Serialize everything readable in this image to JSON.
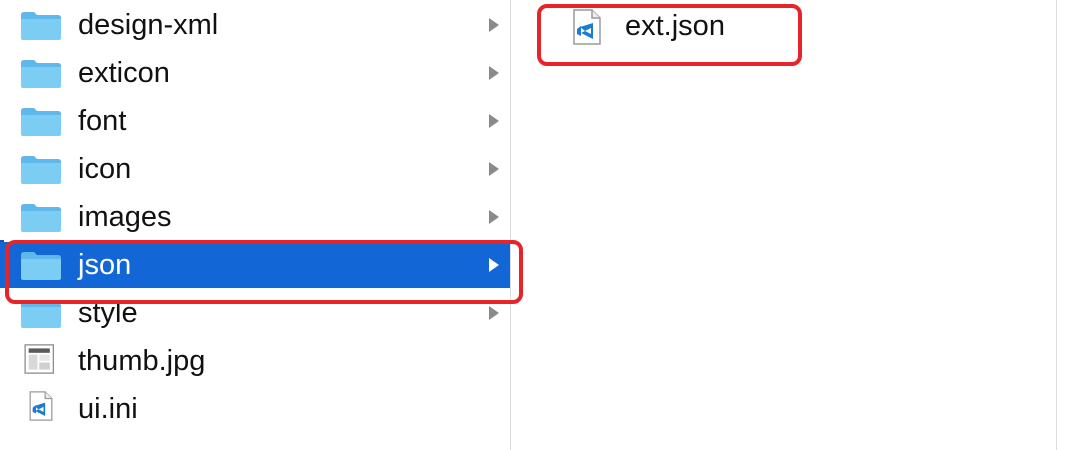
{
  "colors": {
    "selection": "#1266d6",
    "annotation": "#e8242b",
    "folder": "#6cc3ee",
    "vscode_blue": "#1c7bd4"
  },
  "left_column": {
    "items": [
      {
        "label": "design-xml",
        "kind": "folder",
        "icon": "folder-icon"
      },
      {
        "label": "exticon",
        "kind": "folder",
        "icon": "folder-icon"
      },
      {
        "label": "font",
        "kind": "folder",
        "icon": "folder-icon"
      },
      {
        "label": "icon",
        "kind": "folder",
        "icon": "folder-icon"
      },
      {
        "label": "images",
        "kind": "folder",
        "icon": "folder-icon"
      },
      {
        "label": "json",
        "kind": "folder",
        "icon": "folder-icon",
        "selected": true
      },
      {
        "label": "style",
        "kind": "folder",
        "icon": "folder-icon"
      },
      {
        "label": "thumb.jpg",
        "kind": "file",
        "icon": "image-file-icon"
      },
      {
        "label": "ui.ini",
        "kind": "file",
        "icon": "vscode-file-icon"
      }
    ]
  },
  "right_column": {
    "items": [
      {
        "label": "ext.json",
        "kind": "file",
        "icon": "vscode-file-icon"
      }
    ]
  }
}
